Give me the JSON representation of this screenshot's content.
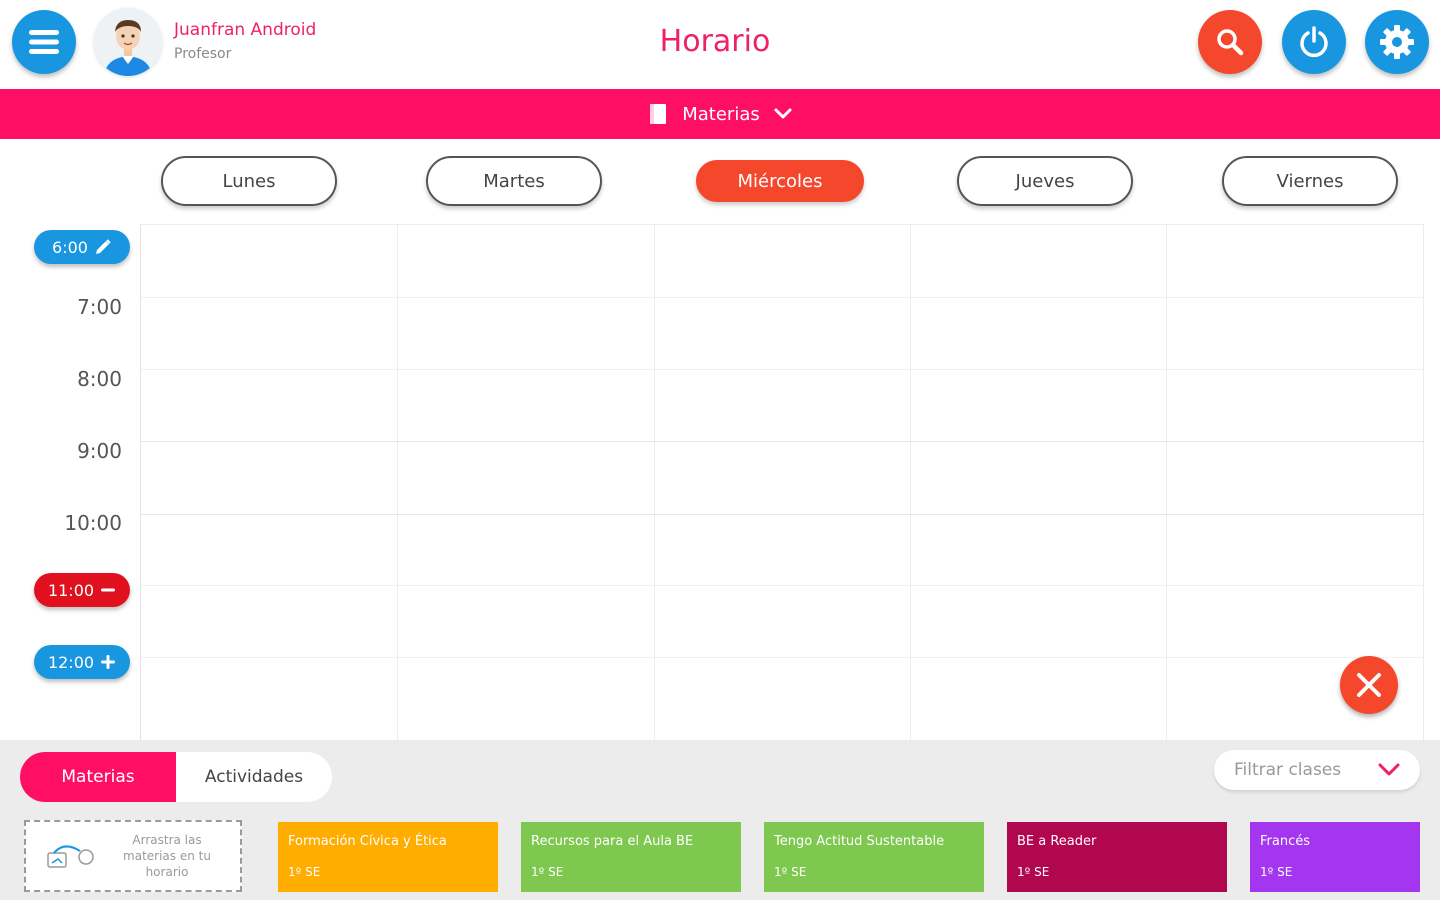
{
  "header": {
    "user_name": "Juanfran Android",
    "user_role": "Profesor",
    "title": "Horario",
    "menu_icon": "hamburger-menu-icon",
    "search_icon": "search-icon",
    "power_icon": "power-icon",
    "settings_icon": "gear-icon"
  },
  "subject_bar": {
    "label": "Materias",
    "icon": "book-icon"
  },
  "days": [
    "Lunes",
    "Martes",
    "Miércoles",
    "Jueves",
    "Viernes"
  ],
  "active_day": "Miércoles",
  "times": {
    "t600": "6:00",
    "t700": "7:00",
    "t800": "8:00",
    "t900": "9:00",
    "t1000": "10:00",
    "t1100": "11:00",
    "t1200": "12:00"
  },
  "bottom": {
    "tab_materias": "Materias",
    "tab_actividades": "Actividades",
    "filter_placeholder": "Filtrar clases",
    "drop_hint": "Arrastra las materias en tu horario"
  },
  "subjects": [
    {
      "name": "Formación Cívica y Ética",
      "grade": "1º SE",
      "color": "#ffad00"
    },
    {
      "name": "Recursos para el Aula BE",
      "grade": "1º SE",
      "color": "#7ec850"
    },
    {
      "name": "Tengo Actitud Sustentable",
      "grade": "1º SE",
      "color": "#7ec850"
    },
    {
      "name": "BE a Reader",
      "grade": "1º SE",
      "color": "#b0074f"
    },
    {
      "name": "Francés",
      "grade": "1º SE",
      "color": "#a536f0"
    }
  ],
  "colors": {
    "accent_pink": "#fe0f64",
    "blue": "#1996e0",
    "orange_red": "#f4472c",
    "red": "#e0101e"
  }
}
